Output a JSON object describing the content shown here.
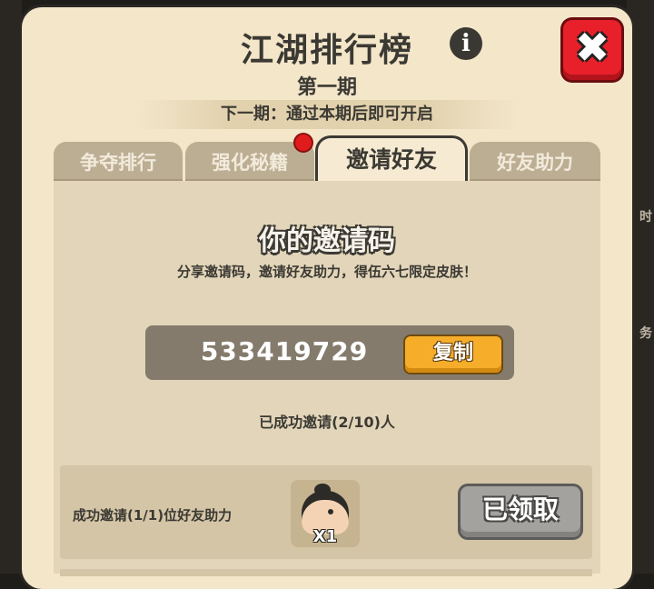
{
  "header": {
    "title": "江湖排行榜",
    "period": "第一期",
    "next_period_note": "下一期：通过本期后即可开启",
    "info_icon": "info-icon",
    "close_icon": "close-icon"
  },
  "tabs": [
    {
      "label": "争夺排行",
      "active": false
    },
    {
      "label": "强化秘籍",
      "active": false,
      "badge": true
    },
    {
      "label": "邀请好友",
      "active": true
    },
    {
      "label": "好友助力",
      "active": false
    }
  ],
  "invite": {
    "section_title": "你的邀请码",
    "description": "分享邀请码，邀请好友助力，得伍六七限定皮肤！",
    "code": "533419729",
    "copy_label": "复制",
    "invited_status": "已成功邀请(2/10)人"
  },
  "rewards": [
    {
      "condition": "成功邀请(1/1)位好友助力",
      "item_icon": "character-avatar-icon",
      "quantity": "X1",
      "button_label": "已领取"
    }
  ],
  "background_edge": {
    "right_hints": [
      "时",
      "务"
    ]
  },
  "colors": {
    "panel": "#f3e6c9",
    "content": "#e2d5b9",
    "close_red": "#e8202a",
    "copy_orange": "#f6ae2a",
    "claimed_gray": "#a3a29f",
    "badge_red": "#e01b1b"
  }
}
